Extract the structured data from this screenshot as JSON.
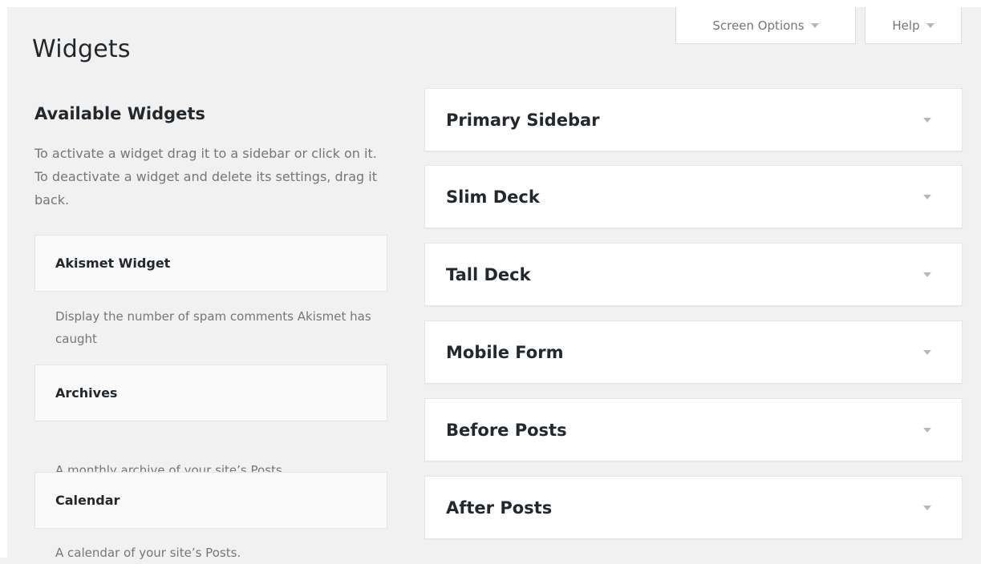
{
  "header": {
    "title": "Widgets",
    "screen_options_label": "Screen Options",
    "help_label": "Help"
  },
  "available": {
    "heading": "Available Widgets",
    "description": "To activate a widget drag it to a sidebar or click on it. To deactivate a widget and delete its settings, drag it back.",
    "widgets": [
      {
        "name": "Akismet Widget",
        "description": "Display the number of spam comments Akismet has caught"
      },
      {
        "name": "Archives",
        "description": "A monthly archive of your site’s Posts."
      },
      {
        "name": "Calendar",
        "description": "A calendar of your site’s Posts."
      }
    ]
  },
  "sidebars": [
    {
      "name": "Primary Sidebar"
    },
    {
      "name": "Slim Deck"
    },
    {
      "name": "Tall Deck"
    },
    {
      "name": "Mobile Form"
    },
    {
      "name": "Before Posts"
    },
    {
      "name": "After Posts"
    }
  ],
  "colors": {
    "background": "#f1f1f1",
    "panel": "#ffffff",
    "heading_text": "#23282d",
    "muted_text": "#72777c",
    "toggle_arrow": "#b4b9be"
  },
  "icons": {
    "dropdown": "triangle-down-icon"
  }
}
